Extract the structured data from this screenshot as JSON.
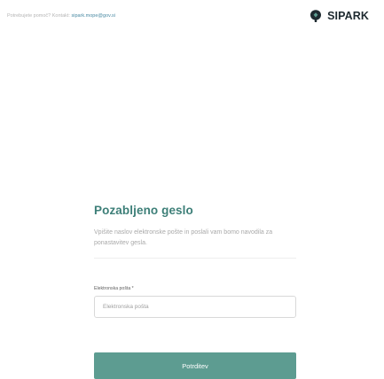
{
  "header": {
    "help_prefix": "Potrebujete pomoč? Kontakt:",
    "help_email": "sipark.mope@gov.si",
    "logo_text": "SIPARK",
    "logo_icon": "sipark-logo-icon"
  },
  "form": {
    "title": "Pozabljeno geslo",
    "description": "Vpišite naslov elektronske pošte in poslali vam bomo navodila za ponastavitev gesla.",
    "email_label": "Elektronska pošta *",
    "email_placeholder": "Elektronska pošta",
    "email_value": "",
    "submit_label": "Potrditev"
  },
  "colors": {
    "accent": "#3d7f78",
    "button": "#5d9c91",
    "link": "#4b8ba4"
  }
}
